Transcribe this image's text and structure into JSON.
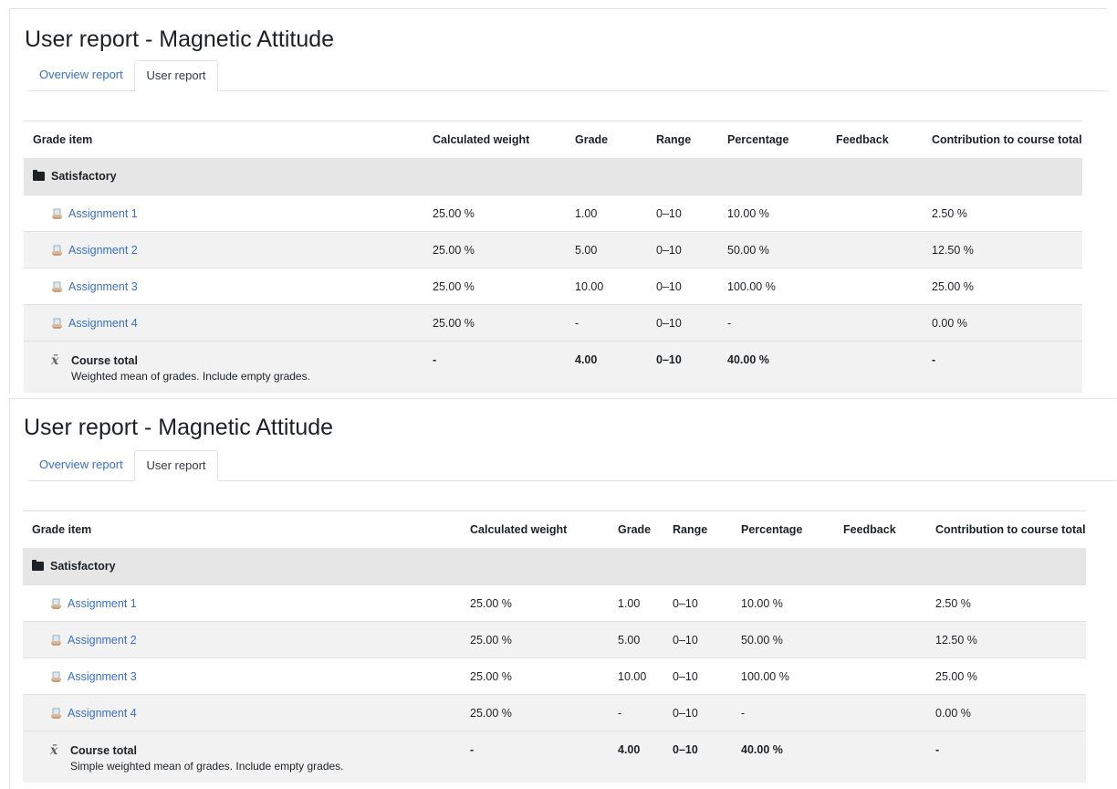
{
  "reports": [
    {
      "title": "User report - Magnetic Attitude",
      "tabs": [
        {
          "label": "Overview report"
        },
        {
          "label": "User report"
        }
      ],
      "columns": [
        "Grade item",
        "Calculated weight",
        "Grade",
        "Range",
        "Percentage",
        "Feedback",
        "Contribution to course total"
      ],
      "category": {
        "name": "Satisfactory"
      },
      "rows": [
        {
          "name": "Assignment 1",
          "weight": "25.00 %",
          "grade": "1.00",
          "range": "0–10",
          "percentage": "10.00 %",
          "feedback": "",
          "contribution": "2.50 %"
        },
        {
          "name": "Assignment 2",
          "weight": "25.00 %",
          "grade": "5.00",
          "range": "0–10",
          "percentage": "50.00 %",
          "feedback": "",
          "contribution": "12.50 %"
        },
        {
          "name": "Assignment 3",
          "weight": "25.00 %",
          "grade": "10.00",
          "range": "0–10",
          "percentage": "100.00 %",
          "feedback": "",
          "contribution": "25.00 %"
        },
        {
          "name": "Assignment 4",
          "weight": "25.00 %",
          "grade": "-",
          "range": "0–10",
          "percentage": "-",
          "feedback": "",
          "contribution": "0.00 %"
        }
      ],
      "total": {
        "name": "Course total",
        "description": "Weighted mean of grades. Include empty grades.",
        "weight": "-",
        "grade": "4.00",
        "range": "0–10",
        "percentage": "40.00 %",
        "feedback": "",
        "contribution": "-"
      }
    },
    {
      "title": "User report - Magnetic Attitude",
      "tabs": [
        {
          "label": "Overview report"
        },
        {
          "label": "User report"
        }
      ],
      "columns": [
        "Grade item",
        "Calculated weight",
        "Grade",
        "Range",
        "Percentage",
        "Feedback",
        "Contribution to course total"
      ],
      "category": {
        "name": "Satisfactory"
      },
      "rows": [
        {
          "name": "Assignment 1",
          "weight": "25.00 %",
          "grade": "1.00",
          "range": "0–10",
          "percentage": "10.00 %",
          "feedback": "",
          "contribution": "2.50 %"
        },
        {
          "name": "Assignment 2",
          "weight": "25.00 %",
          "grade": "5.00",
          "range": "0–10",
          "percentage": "50.00 %",
          "feedback": "",
          "contribution": "12.50 %"
        },
        {
          "name": "Assignment 3",
          "weight": "25.00 %",
          "grade": "10.00",
          "range": "0–10",
          "percentage": "100.00 %",
          "feedback": "",
          "contribution": "25.00 %"
        },
        {
          "name": "Assignment 4",
          "weight": "25.00 %",
          "grade": "-",
          "range": "0–10",
          "percentage": "-",
          "feedback": "",
          "contribution": "0.00 %"
        }
      ],
      "total": {
        "name": "Course total",
        "description": "Simple weighted mean of grades. Include empty grades.",
        "weight": "-",
        "grade": "4.00",
        "range": "0–10",
        "percentage": "40.00 %",
        "feedback": "",
        "contribution": "-"
      }
    }
  ]
}
